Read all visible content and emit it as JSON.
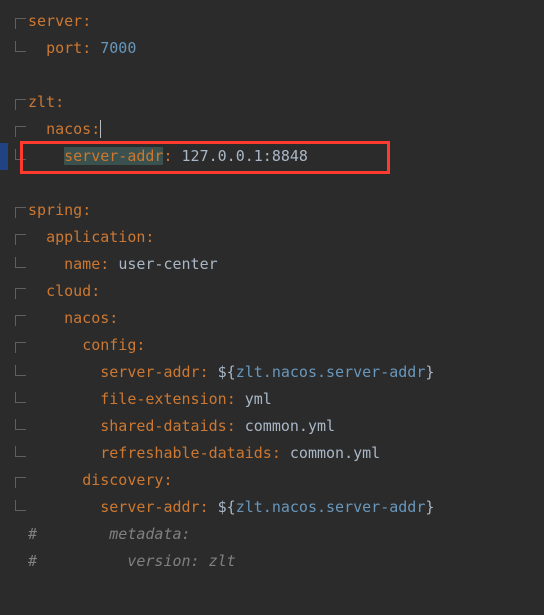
{
  "lines": {
    "l1_key": "server",
    "l2_key": "port",
    "l2_val": "7000",
    "l4_key": "zlt",
    "l5_key": "nacos",
    "l6_key": "server-addr",
    "l6_val": "127.0.0.1:8848",
    "l8_key": "spring",
    "l9_key": "application",
    "l10_key": "name",
    "l10_val": "user-center",
    "l11_key": "cloud",
    "l12_key": "nacos",
    "l13_key": "config",
    "l14_key": "server-addr",
    "l14_ref": "zlt.nacos.server-addr",
    "l15_key": "file-extension",
    "l15_val": "yml",
    "l16_key": "shared-dataids",
    "l16_val": "common.yml",
    "l17_key": "refreshable-dataids",
    "l17_val": "common.yml",
    "l18_key": "discovery",
    "l19_key": "server-addr",
    "l19_ref": "zlt.nacos.server-addr",
    "l20_comment": "metadata:",
    "l21_comment": "version: zlt",
    "hash": "#",
    "dollar_open": "${",
    "brace_close": "}",
    "colon": ":",
    "colon_sp": ": "
  }
}
